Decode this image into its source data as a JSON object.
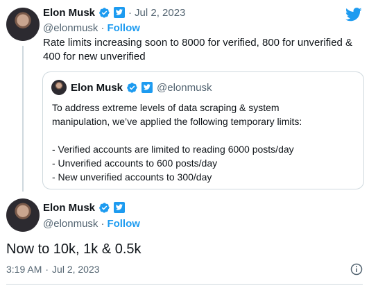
{
  "tweet1": {
    "author_name": "Elon Musk",
    "dot_separator": "·",
    "date": "Jul 2, 2023",
    "handle": "@elonmusk",
    "follow_label": "Follow",
    "text_line1": "Rate limits increasing soon to 8000 for verified, 800 for unverified &",
    "text_line2": "400 for new unverified"
  },
  "quote": {
    "author_name": "Elon Musk",
    "handle": "@elonmusk",
    "text_line1": "To address extreme levels of data scraping & system",
    "text_line2": "manipulation, we’ve applied the following temporary limits:",
    "bullets": [
      "- Verified accounts are limited to reading 6000 posts/day",
      "- Unverified accounts to 600 posts/day",
      "- New unverified accounts to 300/day"
    ]
  },
  "tweet2": {
    "author_name": "Elon Musk",
    "handle": "@elonmusk",
    "follow_label": "Follow",
    "dot_separator": "·",
    "text": "Now to 10k, 1k & 0.5k",
    "time": "3:19 AM",
    "date": "Jul 2, 2023"
  },
  "icons": {
    "verified": "verified-badge-icon",
    "affiliate": "twitter-affiliate-icon",
    "logo": "twitter-logo-icon",
    "info": "info-icon"
  },
  "colors": {
    "accent": "#1d9bf0",
    "text": "#0f1419",
    "muted": "#536471",
    "border": "#cfd9de"
  }
}
